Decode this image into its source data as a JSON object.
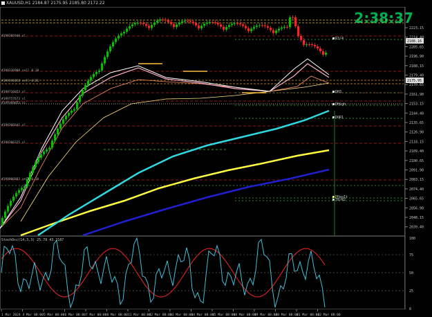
{
  "window": {
    "symbol_title": "XAUUSD,H1",
    "ohlc": "2184.87 2175.95 2185.80 2172.22",
    "indicator_window_title": "StochOsc(14,3,3) 25.78 43.2187"
  },
  "countdown": "2:38:37",
  "colors": {
    "background": "#000000",
    "bull_candle": "#00c000",
    "bear_candle": "#ff2020",
    "ema_fast": "#ffb0d0",
    "ema_mid": "#ffffff",
    "ema_slow": "#ffe080",
    "ma_cyan": "#30d8e0",
    "ma_yellow": "#ffff40",
    "ma_blue": "#2020d0",
    "stoch_main": "#40c0d8",
    "stoch_signal": "#d02020",
    "timer_green": "#00b050"
  },
  "level_labels": [
    "#199385940 sl",
    "#199336988 sell 0.10",
    "#199392058 sell 0.01",
    "#199726053 sl",
    "#199757673 sl",
    "#199309853 sl",
    "#199306641 sl",
    "#199306325 sl",
    "#199006883 sell 0.10"
  ],
  "pivot_labels": [
    "R3/4",
    "DH3",
    "DHigh",
    "DOR1",
    "PPeoIt",
    "TB/R2"
  ],
  "price_axis": {
    "labels": [
      "2223.15",
      "2214.40",
      "2205.65",
      "2196.90",
      "2188.15",
      "2179.40",
      "2170.65",
      "2161.90",
      "2153.15",
      "2144.40",
      "2135.65",
      "2126.90",
      "2118.15",
      "2109.40",
      "2100.65",
      "2091.90",
      "2083.15",
      "2074.40",
      "2065.65",
      "2056.90",
      "2048.15",
      "2039.40"
    ],
    "current_price": "2175.95",
    "ask_price": "2188.16"
  },
  "stoch_axis": [
    "100",
    "75",
    "50",
    "25",
    "0"
  ],
  "time_axis": [
    "1 Mar 2024",
    "4 Mar 08:00",
    "5 Mar 08:00",
    "6 Mar 08:00",
    "7 Mar 08:00",
    "8 Mar 08:00",
    "11 Mar 08:00",
    "12 Mar 08:00",
    "13 Mar 08:00",
    "14 Mar 08:00",
    "15 Mar 08:00",
    "18 Mar 08:00",
    "19 Mar 08:00",
    "20 Mar 08:00",
    "21 Mar 08:00",
    "22 Mar 08:00"
  ]
}
